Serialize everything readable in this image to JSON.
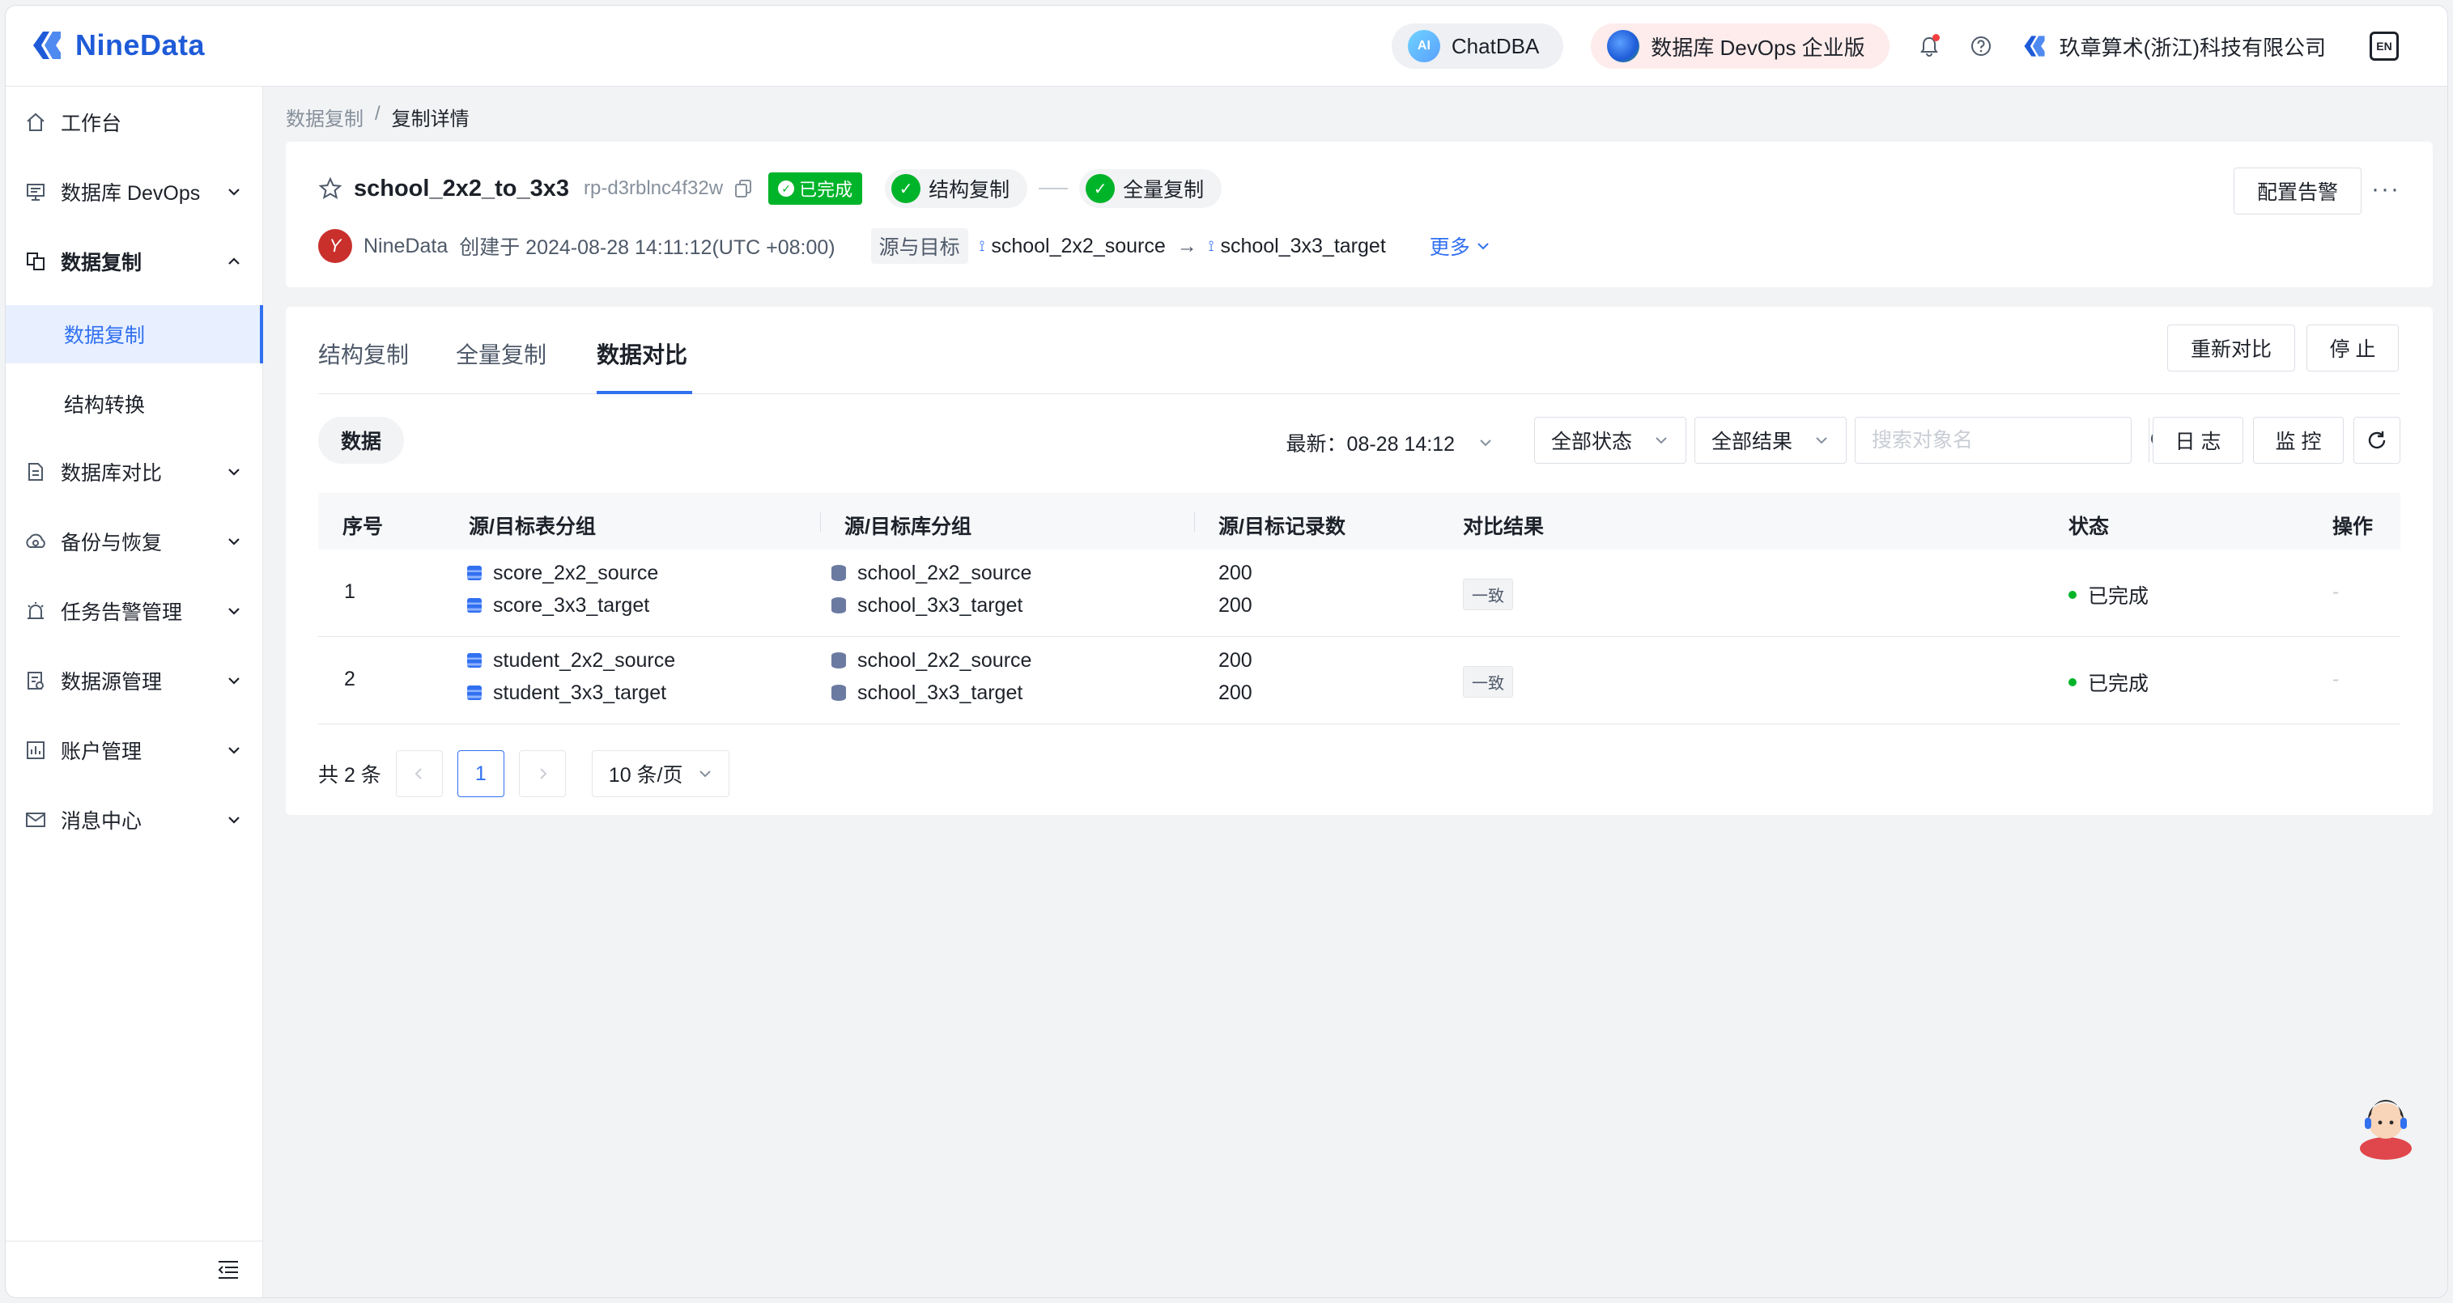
{
  "app": {
    "logo_text": "NineData",
    "brand_color": "#1f5bd8",
    "accent": "#3170f0"
  },
  "header": {
    "chatdba_label": "ChatDBA",
    "chatdba_icon_text": "AI",
    "devops_label": "数据库 DevOps 企业版",
    "company": "玖章算术(浙江)科技有限公司",
    "translate_icon_text": "EN"
  },
  "sidebar": {
    "items": [
      {
        "label": "工作台",
        "icon": "home-icon"
      },
      {
        "label": "数据库 DevOps",
        "icon": "monitor-icon"
      },
      {
        "label": "数据复制",
        "icon": "replication-icon"
      },
      {
        "label": "数据库对比",
        "icon": "compare-icon"
      },
      {
        "label": "备份与恢复",
        "icon": "cloud-backup-icon"
      },
      {
        "label": "任务告警管理",
        "icon": "alarm-icon"
      },
      {
        "label": "数据源管理",
        "icon": "datasource-icon"
      },
      {
        "label": "账户管理",
        "icon": "account-icon"
      },
      {
        "label": "消息中心",
        "icon": "mail-icon"
      }
    ],
    "sub_items": [
      "数据复制",
      "结构转换"
    ]
  },
  "breadcrumb": {
    "parent": "数据复制",
    "separator": "/",
    "current": "复制详情"
  },
  "job": {
    "name": "school_2x2_to_3x3",
    "id": "rp-d3rblnc4f32w",
    "status": "已完成",
    "steps": [
      "结构复制",
      "全量复制"
    ],
    "creator_avatar": "Y",
    "creator": "NineData",
    "created_text": "创建于 2024-08-28 14:11:12(UTC +08:00)",
    "src_target_tag": "源与目标",
    "source": "school_2x2_source",
    "target": "school_3x3_target",
    "more": "更多",
    "alarm_btn": "配置告警",
    "more_dots": "···"
  },
  "tabs": {
    "items": [
      "结构复制",
      "全量复制",
      "数据对比"
    ],
    "active": "数据对比",
    "recompare_btn": "重新对比",
    "stop_btn": "停 止"
  },
  "toolbar": {
    "segment": "数据",
    "latest": "最新：08-28 14:12",
    "status_filter": "全部状态",
    "result_filter": "全部结果",
    "search_placeholder": "搜索对象名",
    "log_btn": "日 志",
    "monitor_btn": "监 控"
  },
  "table": {
    "columns": [
      "序号",
      "源/目标表分组",
      "源/目标库分组",
      "源/目标记录数",
      "对比结果",
      "状态",
      "操作"
    ],
    "rows": [
      {
        "index": "1",
        "src_table": "score_2x2_source",
        "dst_table": "score_3x3_target",
        "src_db": "school_2x2_source",
        "dst_db": "school_3x3_target",
        "src_count": "200",
        "dst_count": "200",
        "result": "一致",
        "status": "已完成",
        "op": "-"
      },
      {
        "index": "2",
        "src_table": "student_2x2_source",
        "dst_table": "student_3x3_target",
        "src_db": "school_2x2_source",
        "dst_db": "school_3x3_target",
        "src_count": "200",
        "dst_count": "200",
        "result": "一致",
        "status": "已完成",
        "op": "-"
      }
    ]
  },
  "pagination": {
    "total": "共 2 条",
    "current_page": "1",
    "page_size": "10 条/页"
  }
}
